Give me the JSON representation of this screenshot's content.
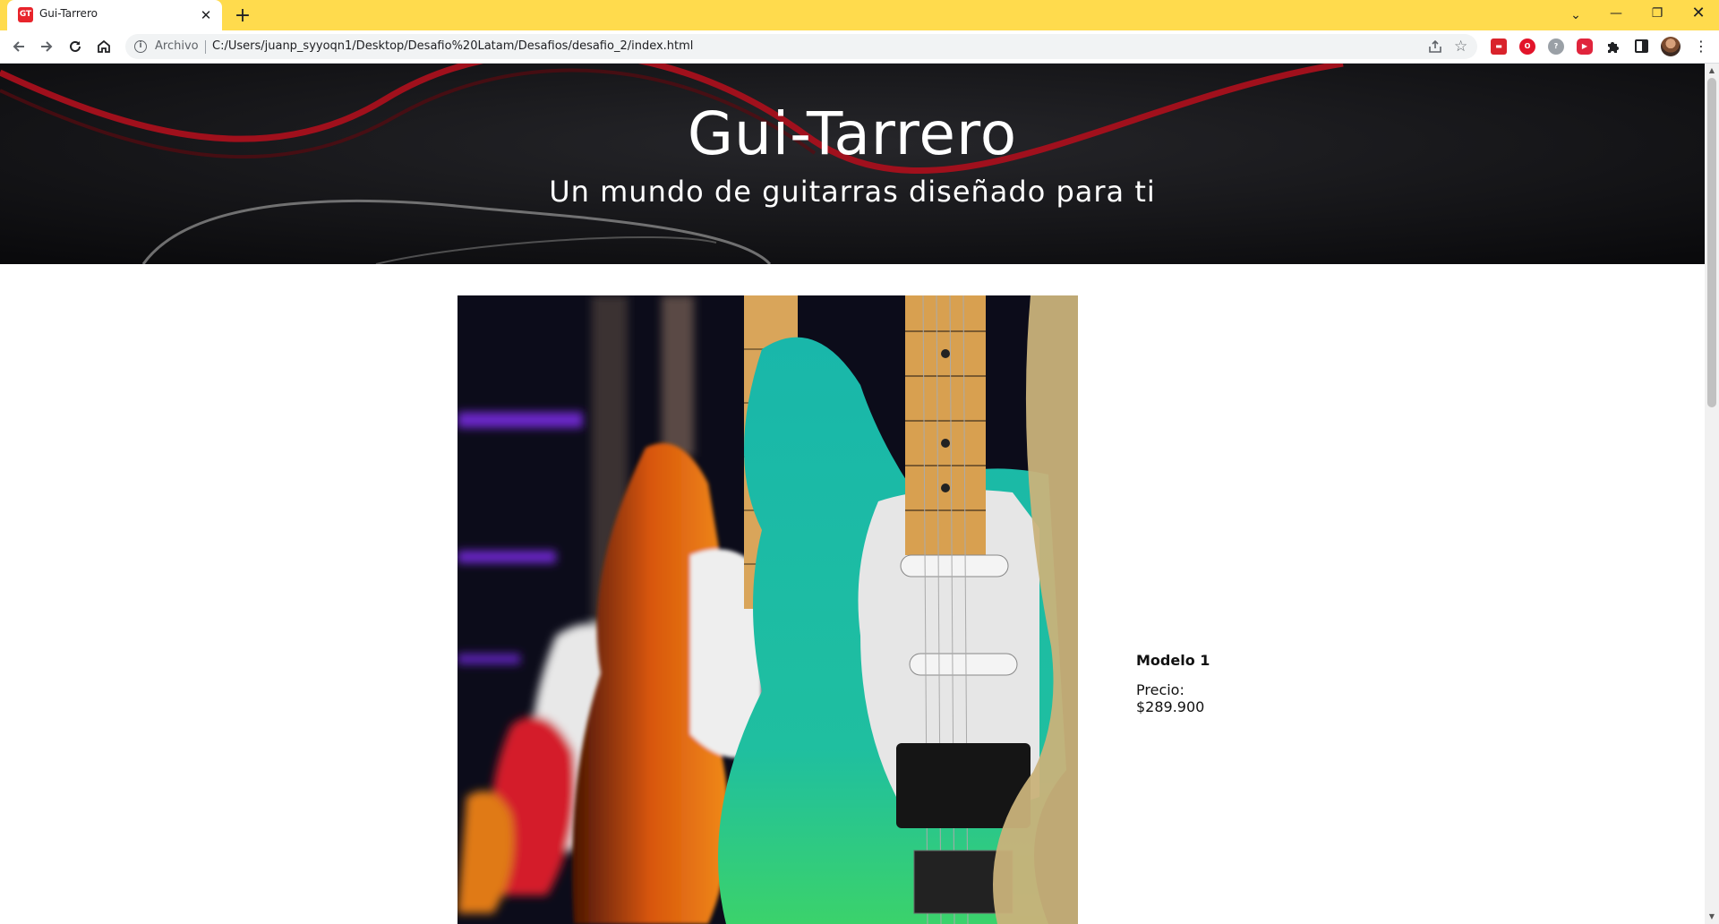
{
  "browser": {
    "tab": {
      "title": "Gui-Tarrero",
      "favicon_text": "GT",
      "favicon_color": "#e8242b"
    },
    "tabstrip_color": "#ffdb4d",
    "omnibox": {
      "scheme_label": "Archivo",
      "url": "C:/Users/juanp_syyoqn1/Desktop/Desafio%20Latam/Desafios/desafio_2/index.html"
    },
    "extensions": [
      "red-extension-icon",
      "opera-extension-icon",
      "grey-extension-icon",
      "red-play-extension-icon"
    ]
  },
  "hero": {
    "title": "Gui-Tarrero",
    "subtitle": "Un mundo de guitarras diseñado para ti"
  },
  "products": [
    {
      "name": "Modelo 1",
      "price_label": "Precio:",
      "price": "$289.900"
    }
  ]
}
